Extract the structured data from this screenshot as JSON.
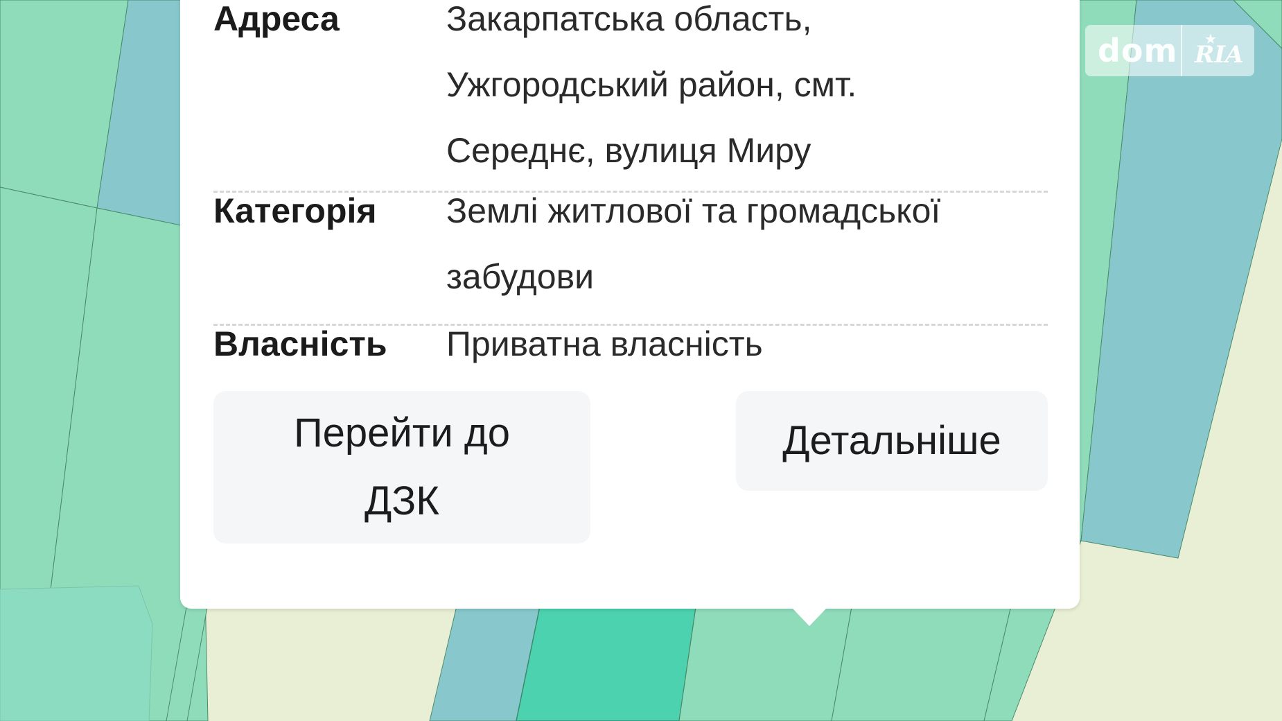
{
  "popup": {
    "rows": [
      {
        "label": "Адреса",
        "lines": [
          "Закарпатська область,",
          "Ужгородський район, смт.",
          "Середнє, вулиця Миру"
        ]
      },
      {
        "label": "Категорія",
        "lines": [
          "Землі житлової та громадської",
          "забудови"
        ]
      },
      {
        "label": "Власність",
        "lines": [
          "Приватна власність"
        ]
      }
    ],
    "buttons": {
      "go_to_dzk": "Перейти до ДЗК",
      "details": "Детальніше"
    }
  },
  "watermark": {
    "brand_left": "dom",
    "brand_right": "RIA"
  },
  "map": {
    "colors": {
      "light_green": "#8fdcbb",
      "teal_blue": "#88c8cc",
      "bright_teal": "#4cd2ae",
      "pale_yellow": "#e9efd4",
      "parcel_border": "#4a8a6a"
    }
  }
}
